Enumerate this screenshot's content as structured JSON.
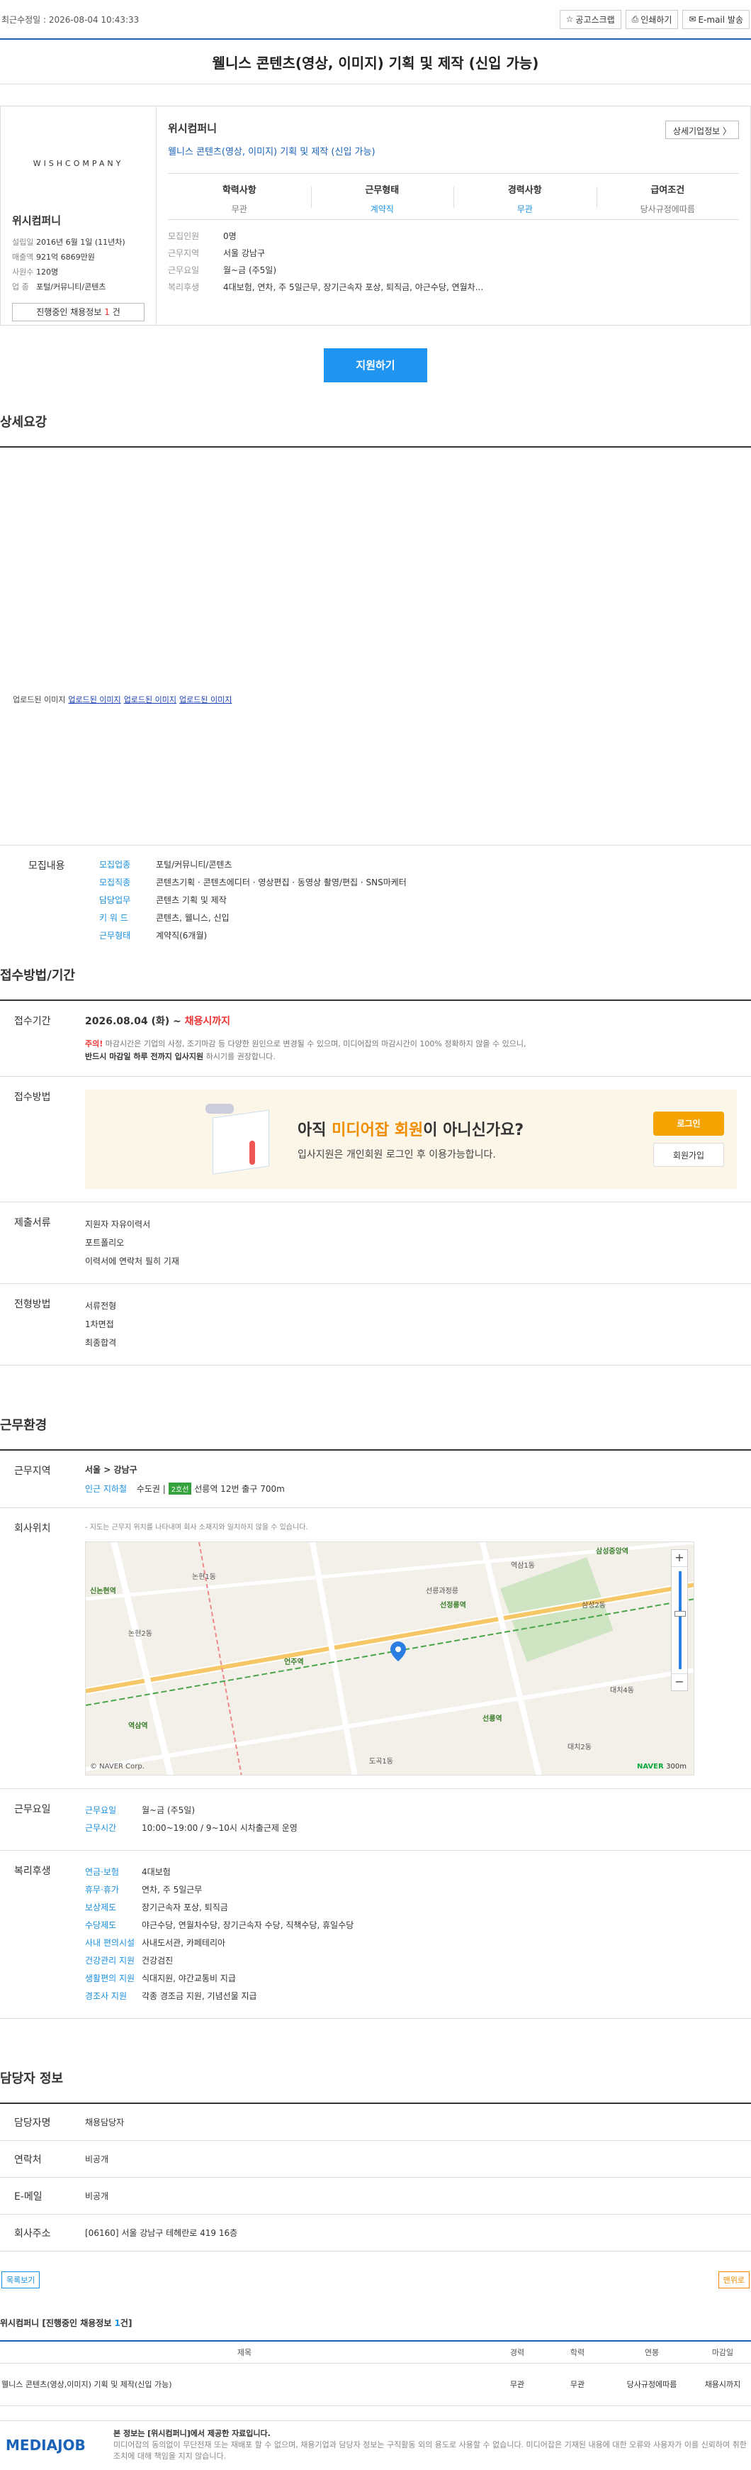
{
  "topbar": {
    "date": "최근수정일 : 2026-08-04 10:43:33",
    "scrap": "공고스크랩",
    "print": "인쇄하기",
    "email": "E-mail 발송"
  },
  "title": "웰니스 콘텐츠(영상, 이미지) 기획 및 제작 (신입 가능)",
  "company": {
    "logo_text": "WISHCOMPANY",
    "name": "위시컴퍼니",
    "facts": [
      {
        "k": "설립일",
        "v": "2016년 6월 1일 (11년차)"
      },
      {
        "k": "매출액",
        "v": "921억 6869만원"
      },
      {
        "k": "사원수",
        "v": "120명"
      },
      {
        "k": "업    종",
        "v": "포털/커뮤니티/콘텐츠"
      }
    ],
    "current_label": "진행중인 채용정보",
    "current_count": "1",
    "current_unit": "건",
    "detail_btn": "상세기업정보"
  },
  "job": {
    "company": "위시컴퍼니",
    "title": "웰니스 콘텐츠(영상, 이미지) 기획 및 제작 (신입 가능)",
    "conditions": [
      {
        "h": "학력사항",
        "v": "무관"
      },
      {
        "h": "근무형태",
        "v": "계약직"
      },
      {
        "h": "경력사항",
        "v": "무관"
      },
      {
        "h": "급여조건",
        "v": "당사규정에따름"
      }
    ],
    "summary": [
      {
        "k": "모집인원",
        "v": "0명"
      },
      {
        "k": "근무지역",
        "v": "서울 강남구"
      },
      {
        "k": "근무요일",
        "v": "월~금 (주5일)"
      },
      {
        "k": "복리후생",
        "v": "4대보험, 연차, 주 5일근무, 장기근속자 포상, 퇴직금, 야근수당, 연월차..."
      }
    ]
  },
  "apply_button": "지원하기",
  "sections": {
    "detail": "상세요강",
    "apply": "접수방법/기간",
    "env": "근무환경",
    "contact": "담당자 정보"
  },
  "images": [
    "업로드된 이미지",
    "업로드된 이미지",
    "업로드된 이미지",
    "업로드된 이미지"
  ],
  "recruit": {
    "label": "모집내용",
    "rows": [
      {
        "k": "모집업종",
        "v": "포털/커뮤니티/콘텐츠"
      },
      {
        "k": "모집직종",
        "v": "콘텐츠기획 · 콘텐츠에디터 · 영상편집 · 동영상 촬영/편집 · SNS마케터"
      },
      {
        "k": "담당업무",
        "v": "콘텐츠 기획 및 제작"
      },
      {
        "k": "키 워 드",
        "v": "콘텐츠, 웰니스, 신입"
      },
      {
        "k": "근무형태",
        "v": "계약직(6개월)"
      }
    ]
  },
  "apply": {
    "period_label": "접수기간",
    "period": "2026.08.04 (화) ~",
    "period_end": "채용시까지",
    "notice_prefix": "주의!",
    "notice": "마감시간은 기업의 사정, 조기마감 등 다양한 원인으로 변경될 수 있으며, 미디어잡의 마감시간이 100% 정확하지 않을 수 있으니,",
    "notice2": "반드시 마감일 하루 전까지 입사지원",
    "notice3": "하시기를 권장합니다.",
    "method_label": "접수방법",
    "banner_big_pre": "아직 ",
    "banner_big_hl": "미디어잡 회원",
    "banner_big_post": "이 아니신가요?",
    "banner_small": "입사지원은 개인회원 로그인 후 이용가능합니다.",
    "login": "로그인",
    "join": "회원가입",
    "docs_label": "제출서류",
    "docs": [
      "지원자 자유이력서",
      "포트폴리오",
      "이력서에 연락처 필히 기재"
    ],
    "process_label": "전형방법",
    "process": [
      "서류전형",
      "1차면접",
      "최종합격"
    ]
  },
  "env": {
    "area_label": "근무지역",
    "area": "서울 > 강남구",
    "subway_k": "인근 지하철",
    "subway_station": "수도권 |",
    "subway_line": "2호선",
    "subway_rest": "선릉역 12번 출구 700m",
    "loc_label": "회사위치",
    "map_note": "- 지도는 근무지 위치를 나타내며 회사 소재지와 일치하지 않을 수 있습니다.",
    "map_copy": "© NAVER Corp.",
    "map_naver": "NAVER",
    "map_scale": "300m",
    "map_labels": [
      "논현1동",
      "역삼1동",
      "신논현역",
      "선릉역",
      "삼성중앙역",
      "언주역",
      "역삼역",
      "도곡1동",
      "대치2동",
      "선정릉역",
      "선릉과정릉",
      "논현2동",
      "삼성2동",
      "대치4동"
    ],
    "days_label": "근무요일",
    "days": [
      {
        "k": "근무요일",
        "v": "월~금 (주5일)"
      },
      {
        "k": "근무시간",
        "v": "10:00~19:00 / 9~10시 시차출근제 운영"
      }
    ],
    "welfare_label": "복리후생",
    "welfare": [
      {
        "k": "연금·보험",
        "v": "4대보험"
      },
      {
        "k": "휴무·휴가",
        "v": "연차, 주 5일근무"
      },
      {
        "k": "보상제도",
        "v": "장기근속자 포상, 퇴직금"
      },
      {
        "k": "수당제도",
        "v": "야근수당, 연월차수당, 장기근속자 수당, 직책수당, 휴일수당"
      },
      {
        "k": "사내 편의시설",
        "v": "사내도서관, 카페테리아"
      },
      {
        "k": "건강관리 지원",
        "v": "건강검진"
      },
      {
        "k": "생활편의 지원",
        "v": "식대지원, 야간교통비 지급"
      },
      {
        "k": "경조사 지원",
        "v": "각종 경조금 지원, 기념선물 지급"
      }
    ]
  },
  "contact": [
    {
      "k": "담당자명",
      "v": "채용담당자"
    },
    {
      "k": "연락처",
      "v": "비공개"
    },
    {
      "k": "E-메일",
      "v": "비공개"
    },
    {
      "k": "회사주소",
      "v": "[06160] 서울 강남구 테헤란로 419 16층"
    }
  ],
  "bottom_btns": {
    "list": "목록보기",
    "top": "맨위로"
  },
  "current_jobs": {
    "title_pre": "위시컴퍼니 [진행중인 채용정보 ",
    "title_count": "1",
    "title_post": "건]",
    "headers": [
      "제목",
      "경력",
      "학력",
      "연봉",
      "마감일"
    ],
    "rows": [
      {
        "title": "웰니스 콘텐츠(영상,이미지) 기획 및 제작(신입 가능)",
        "career": "무관",
        "edu": "무관",
        "salary": "당사규정에따름",
        "deadline": "채용시까지"
      }
    ]
  },
  "footer": {
    "logo": "MEDIAJOB",
    "line1_pre": "본 정보는 [",
    "line1_name": "위시컴퍼니",
    "line1_post": "]에서 제공한 자료입니다.",
    "line2": "미디어잡의 동의없이 무단전재 또는 재배포 할 수 없으며, 채용기업과 담당자 정보는 구직활동 외의 용도로 사용할 수 없습니다. 미디어잡은 기재된 내용에 대한 오류와 사용자가 이를 신뢰하여 취한 조치에 대해 책임을 지지 않습니다."
  }
}
